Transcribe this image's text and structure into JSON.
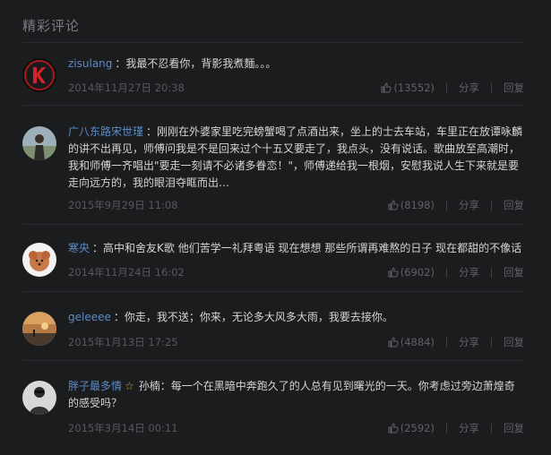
{
  "section_title": "精彩评论",
  "comments": [
    {
      "username": "zisulang",
      "separator": "：",
      "text": "我最不忍看你，背影我煮麵。。。",
      "time": "2014年11月27日 20:38",
      "likes": "(13552)",
      "share": "分享",
      "reply": "回复"
    },
    {
      "username": "广八东路宋世瑾",
      "separator": "：",
      "text": "刚刚在外婆家里吃完螃蟹喝了点酒出来，坐上的士去车站，车里正在放谭咏麟的讲不出再见，师傅问我是不是回来过个十五又要走了，我点头，没有说话。歌曲放至高潮时，我和师傅一齐唱出\"要走一刻请不必诸多眷恋！\"，师傅递给我一根烟，安慰我说人生下来就是要走向远方的，我的眼泪夺眶而出…",
      "time": "2015年9月29日 11:08",
      "likes": "(8198)",
      "share": "分享",
      "reply": "回复"
    },
    {
      "username": "寒央",
      "separator": "：",
      "text": "高中和舍友K歌 他们苦学一礼拜粤语 现在想想 那些所谓再难熬的日子 现在都甜的不像话",
      "time": "2014年11月24日 16:02",
      "likes": "(6902)",
      "share": "分享",
      "reply": "回复"
    },
    {
      "username": "geleeee",
      "separator": "：",
      "text": "你走，我不送；你来，无论多大风多大雨，我要去接你。",
      "time": "2015年1月13日 17:25",
      "likes": "(4884)",
      "share": "分享",
      "reply": "回复"
    },
    {
      "username": "胖子最多情",
      "vip_badge": "☆",
      "separator": "：",
      "text": "孙楠：每一个在黑暗中奔跑久了的人总有见到曙光的一天。你考虑过旁边萧煌奇的感受吗？",
      "time": "2015年3月14日 00:11",
      "likes": "(2592)",
      "share": "分享",
      "reply": "回复"
    }
  ]
}
